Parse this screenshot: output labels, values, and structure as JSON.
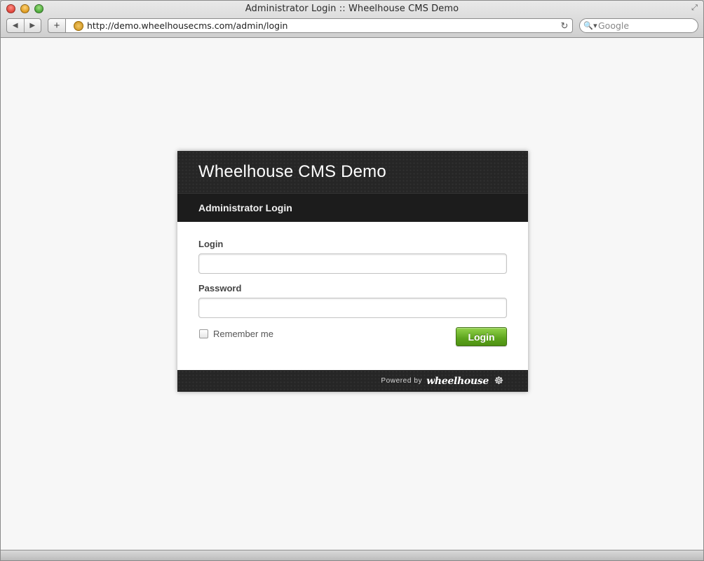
{
  "window": {
    "title": "Administrator Login :: Wheelhouse CMS Demo"
  },
  "browser": {
    "url": "http://demo.wheelhousecms.com/admin/login",
    "search_placeholder": "Google",
    "back_icon": "◀",
    "forward_icon": "▶",
    "add_icon": "+",
    "reload_icon": "↻",
    "search_icon": "🔍▾"
  },
  "page": {
    "site_title": "Wheelhouse CMS Demo",
    "subtitle": "Administrator Login",
    "form": {
      "login_label": "Login",
      "login_value": "",
      "password_label": "Password",
      "password_value": "",
      "remember_label": "Remember me",
      "remember_checked": false,
      "submit_label": "Login"
    },
    "footer": {
      "powered_by": "Powered by",
      "brand": "wheelhouse"
    }
  },
  "colors": {
    "accent_green": "#5da41d",
    "header_dark": "#262626"
  }
}
